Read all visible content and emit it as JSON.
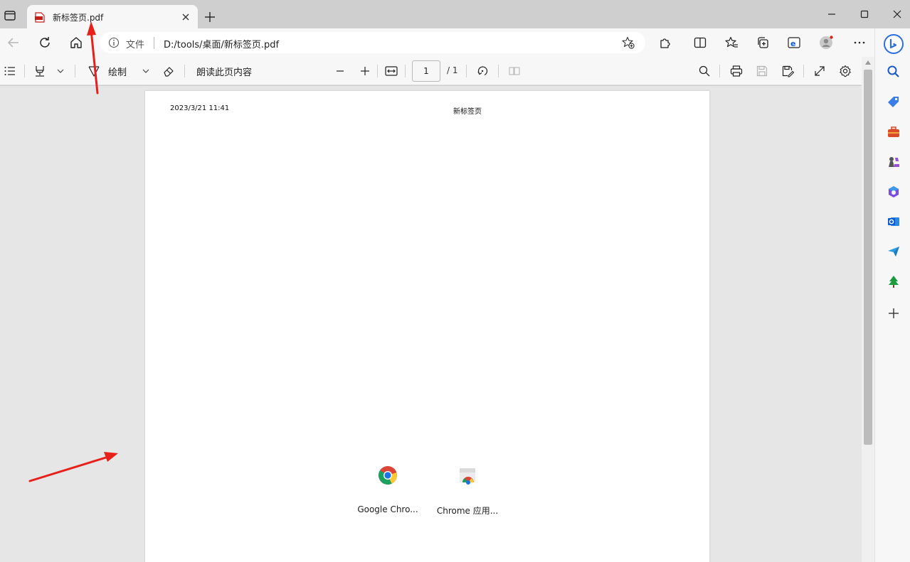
{
  "tab": {
    "title": "新标签页.pdf",
    "favicon_label": "PDF"
  },
  "address_bar": {
    "label": "文件",
    "url": "D:/tools/桌面/新标签页.pdf"
  },
  "pdf_toolbar": {
    "draw_label": "绘制",
    "read_aloud_label": "朗读此页内容",
    "current_page": "1",
    "page_total": "/ 1"
  },
  "pdf_page": {
    "header_date": "2023/3/21 11:41",
    "header_title": "新标签页",
    "apps": [
      {
        "label": "Google Chro...",
        "icon": "chrome-icon"
      },
      {
        "label": "Chrome 应用...",
        "icon": "chrome-apps-icon"
      }
    ]
  },
  "sidebar": {
    "icons": [
      "bing-icon",
      "search-icon",
      "shopping-tag-icon",
      "tools-briefcase-icon",
      "games-chess-icon",
      "microsoft365-icon",
      "outlook-icon",
      "telegram-send-icon",
      "tree-icon",
      "add-icon"
    ]
  },
  "colors": {
    "annotation": "#e8201a",
    "accent": "#0a5ad4"
  }
}
